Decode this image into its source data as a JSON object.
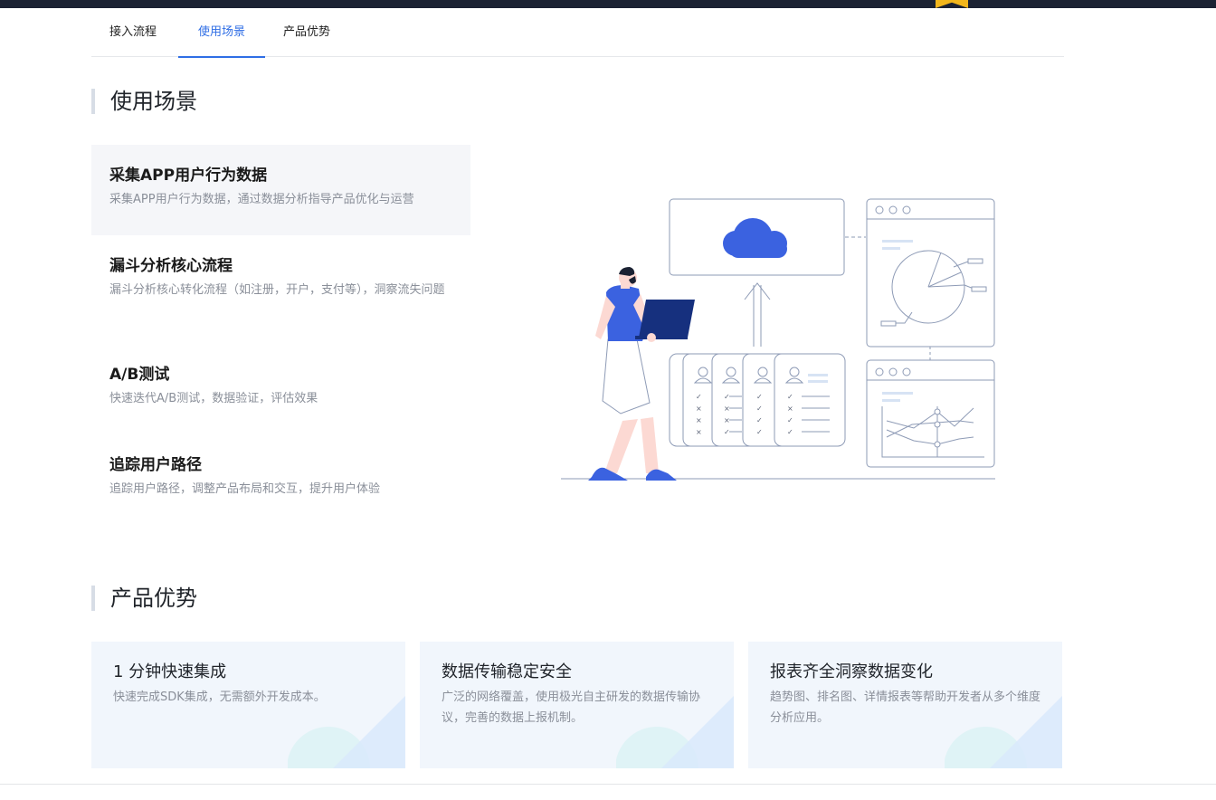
{
  "tabs": [
    {
      "label": "接入流程"
    },
    {
      "label": "使用场景"
    },
    {
      "label": "产品优势"
    }
  ],
  "scenarios_section": {
    "title": "使用场景",
    "items": [
      {
        "title": "采集APP用户行为数据",
        "desc": "采集APP用户行为数据，通过数据分析指导产品优化与运营"
      },
      {
        "title": "漏斗分析核心流程",
        "desc": "漏斗分析核心转化流程（如注册，开户，支付等），洞察流失问题"
      },
      {
        "title": "A/B测试",
        "desc": "快速迭代A/B测试，数据验证，评估效果"
      },
      {
        "title": "追踪用户路径",
        "desc": "追踪用户路径，调整产品布局和交互，提升用户体验"
      }
    ]
  },
  "advantages_section": {
    "title": "产品优势",
    "cards": [
      {
        "title": "1 分钟快速集成",
        "desc": "快速完成SDK集成，无需额外开发成本。"
      },
      {
        "title": "数据传输稳定安全",
        "desc": "广泛的网络覆盖，使用极光自主研发的数据传输协议，完善的数据上报机制。"
      },
      {
        "title": "报表齐全洞察数据变化",
        "desc": "趋势图、排名图、详情报表等帮助开发者从多个维度分析应用。"
      }
    ]
  },
  "colors": {
    "accent": "#2f6ee5",
    "topbar": "#1b2233",
    "card_bg": "#f1f6fc",
    "active_bg": "#f5f6f9"
  },
  "icons": [
    "bookmark-icon",
    "cloud-icon",
    "pie-chart-icon",
    "line-chart-icon",
    "user-profile-icon"
  ]
}
